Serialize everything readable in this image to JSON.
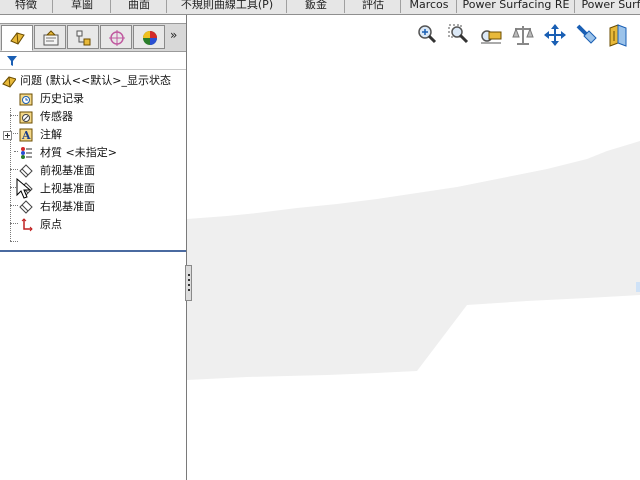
{
  "command_tabs": [
    {
      "label": "特徵"
    },
    {
      "label": "草圖"
    },
    {
      "label": "曲面"
    },
    {
      "label": "不規則曲線工具(P)"
    },
    {
      "label": "鈑金"
    },
    {
      "label": "評估"
    },
    {
      "label": "Marcos"
    },
    {
      "label": "Power Surfacing RE"
    },
    {
      "label": "Power Surf"
    }
  ],
  "feature_manager": {
    "tabs": [
      {
        "icon": "feature-manager-icon",
        "active": true
      },
      {
        "icon": "property-manager-icon",
        "active": false
      },
      {
        "icon": "configuration-manager-icon",
        "active": false
      },
      {
        "icon": "dimxpert-manager-icon",
        "active": false
      },
      {
        "icon": "display-manager-icon",
        "active": false
      }
    ],
    "more_glyph": "»",
    "filter_icon": "filter-icon",
    "root_label": "问题  (默认<<默认>_显示状态",
    "items": [
      {
        "label": "历史记录",
        "icon": "history-icon",
        "expandable": false
      },
      {
        "label": "传感器",
        "icon": "sensor-icon",
        "expandable": false
      },
      {
        "label": "注解",
        "icon": "annotation-icon",
        "expandable": true,
        "expander": "+"
      },
      {
        "label": "材質 <未指定>",
        "icon": "material-icon",
        "expandable": false
      },
      {
        "label": "前视基准面",
        "icon": "plane-icon",
        "expandable": false
      },
      {
        "label": "上视基准面",
        "icon": "plane-icon",
        "expandable": false
      },
      {
        "label": "右视基准面",
        "icon": "plane-icon",
        "expandable": false
      },
      {
        "label": "原点",
        "icon": "origin-icon",
        "expandable": false
      }
    ]
  },
  "view_toolbar": [
    {
      "icon": "zoom-to-fit-icon"
    },
    {
      "icon": "zoom-to-area-icon"
    },
    {
      "icon": "previous-view-icon"
    },
    {
      "icon": "section-view-icon"
    },
    {
      "icon": "view-orientation-icon"
    },
    {
      "icon": "display-style-icon"
    },
    {
      "icon": "hide-show-items-icon"
    }
  ],
  "colors": {
    "tab_bg": "#e6e6e6",
    "panel_bg": "#ffffff",
    "viewport_shape": "#efefef",
    "selection_line": "#4a6aa0",
    "accent_blue": "#1a5fb4"
  }
}
